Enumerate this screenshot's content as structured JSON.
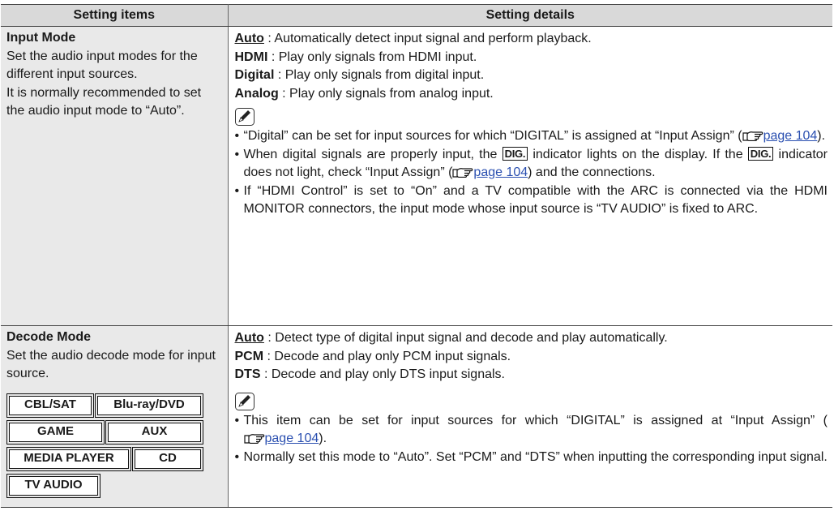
{
  "table": {
    "headers": {
      "items": "Setting items",
      "details": "Setting details"
    },
    "rows": [
      {
        "title": "Input Mode",
        "description": "Set the audio input modes for the different input sources.",
        "description2": "It is normally recommended to set the audio input mode to “Auto”.",
        "options": [
          {
            "name": "Auto",
            "text": " : Automatically detect input signal and perform playback."
          },
          {
            "name": "HDMI",
            "text": " : Play only signals from HDMI input."
          },
          {
            "name": "Digital",
            "text": " : Play only signals from digital input."
          },
          {
            "name": "Analog",
            "text": " : Play only signals from analog input."
          }
        ],
        "notes": {
          "n1_a": "“Digital” can be set for input sources for which “DIGITAL” is assigned at “Input Assign” (",
          "n1_link": "page 104",
          "n1_b": ").",
          "n2_a": "When digital signals are properly input, the ",
          "n2_badge": "DIG.",
          "n2_b": " indicator lights on the display. If the ",
          "n2_c": " indicator does not light, check “Input Assign” (",
          "n2_link": "page 104",
          "n2_d": ") and the connections.",
          "n3": "If “HDMI Control” is set to “On” and a TV compatible with the ARC is connected via the HDMI MONITOR connectors, the input mode whose input source is “TV AUDIO” is fixed to ARC."
        }
      },
      {
        "title": "Decode Mode",
        "description": "Set the audio decode mode for input source.",
        "sources": [
          "CBL/SAT",
          "Blu-ray/DVD",
          "GAME",
          "AUX",
          "MEDIA PLAYER",
          "CD",
          "TV AUDIO"
        ],
        "options": [
          {
            "name": "Auto",
            "text": " : Detect type of digital input signal and decode and play automatically."
          },
          {
            "name": "PCM",
            "text": " : Decode and play only PCM input signals."
          },
          {
            "name": "DTS",
            "text": " : Decode and play only DTS input signals."
          }
        ],
        "notes": {
          "n1_a": "This item can be set for input sources for which “DIGITAL” is assigned at “Input Assign” (",
          "n1_link": "page 104",
          "n1_b": ").",
          "n2": "Normally set this mode to “Auto”. Set “PCM” and “DTS” when inputting the corresponding input signal."
        }
      }
    ]
  },
  "colors": {
    "header_bg": "#d9d9d9",
    "left_bg": "#e9e9e9",
    "link": "#2a4fb0"
  },
  "icons": {
    "note": "pencil-note-icon",
    "reference": "pointing-hand-icon"
  }
}
